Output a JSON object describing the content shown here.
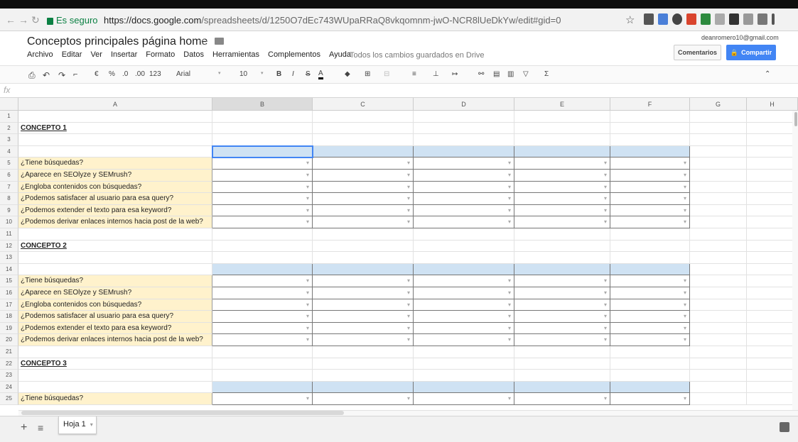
{
  "browser": {
    "secure_label": "Es seguro",
    "url_domain": "https://docs.google.com",
    "url_path": "/spreadsheets/d/1250O7dEc743WUpaRRaQ8vkqomnm-jwO-NCR8lUeDkYw/edit#gid=0"
  },
  "doc": {
    "title": "Conceptos principales página home",
    "saved_status": "Todos los cambios guardados en Drive",
    "account": "deanromero10@gmail.com",
    "comments_label": "Comentarios",
    "share_label": "Compartir"
  },
  "menu": [
    "Archivo",
    "Editar",
    "Ver",
    "Insertar",
    "Formato",
    "Datos",
    "Herramientas",
    "Complementos",
    "Ayuda"
  ],
  "toolbar": {
    "currency": "€",
    "percent": "%",
    "dec_less": ".0",
    "dec_more": ".00",
    "format": "123",
    "font": "Arial",
    "font_size": "10",
    "bold": "B",
    "italic": "I",
    "strike": "S",
    "text_color": "A",
    "sum": "Σ",
    "formula_icon": "fx"
  },
  "columns": [
    "A",
    "B",
    "C",
    "D",
    "E",
    "F",
    "G",
    "H"
  ],
  "concepts": [
    "CONCEPTO 1",
    "CONCEPTO 2",
    "CONCEPTO 3"
  ],
  "questions": [
    "¿Tiene búsquedas?",
    "¿Aparece en SEOlyze y SEMrush?",
    "¿Engloba contenidos con búsquedas?",
    "¿Podemos satisfacer al usuario para esa query?",
    "¿Podemos extender el texto para esa keyword?",
    "¿Podemos derivar enlaces internos hacia post de la web?"
  ],
  "sheet_tab": "Hoja 1",
  "colors": {
    "question_bg": "#fff2cc",
    "header_bg": "#cfe2f3",
    "accent": "#4285f4",
    "brand": "#0f9d58"
  }
}
